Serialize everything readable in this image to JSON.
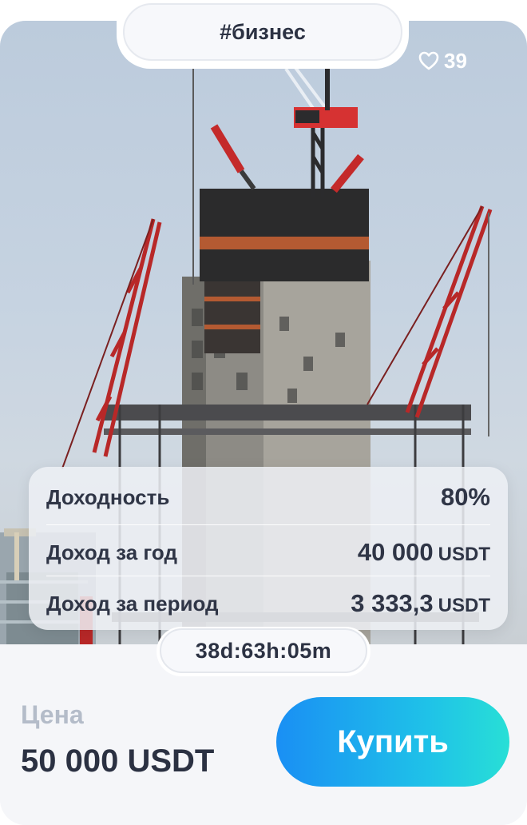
{
  "tag": "#бизнес",
  "likes": {
    "icon": "heart-icon",
    "count": "39"
  },
  "stats": {
    "rows": [
      {
        "label": "Доходность",
        "value": "80%",
        "unit": ""
      },
      {
        "label": "Доход за год",
        "value": "40 000",
        "unit": "USDT"
      },
      {
        "label": "Доход за период",
        "value": "3 333,3",
        "unit": "USDT"
      }
    ]
  },
  "timer": "38d:63h:05m",
  "price": {
    "label": "Цена",
    "value": "50 000 USDT"
  },
  "buy_label": "Купить",
  "colors": {
    "accent_start": "#1a8ff4",
    "accent_end": "#28dfd6",
    "text_dark": "#2b3142",
    "muted": "#b4bcc9"
  }
}
